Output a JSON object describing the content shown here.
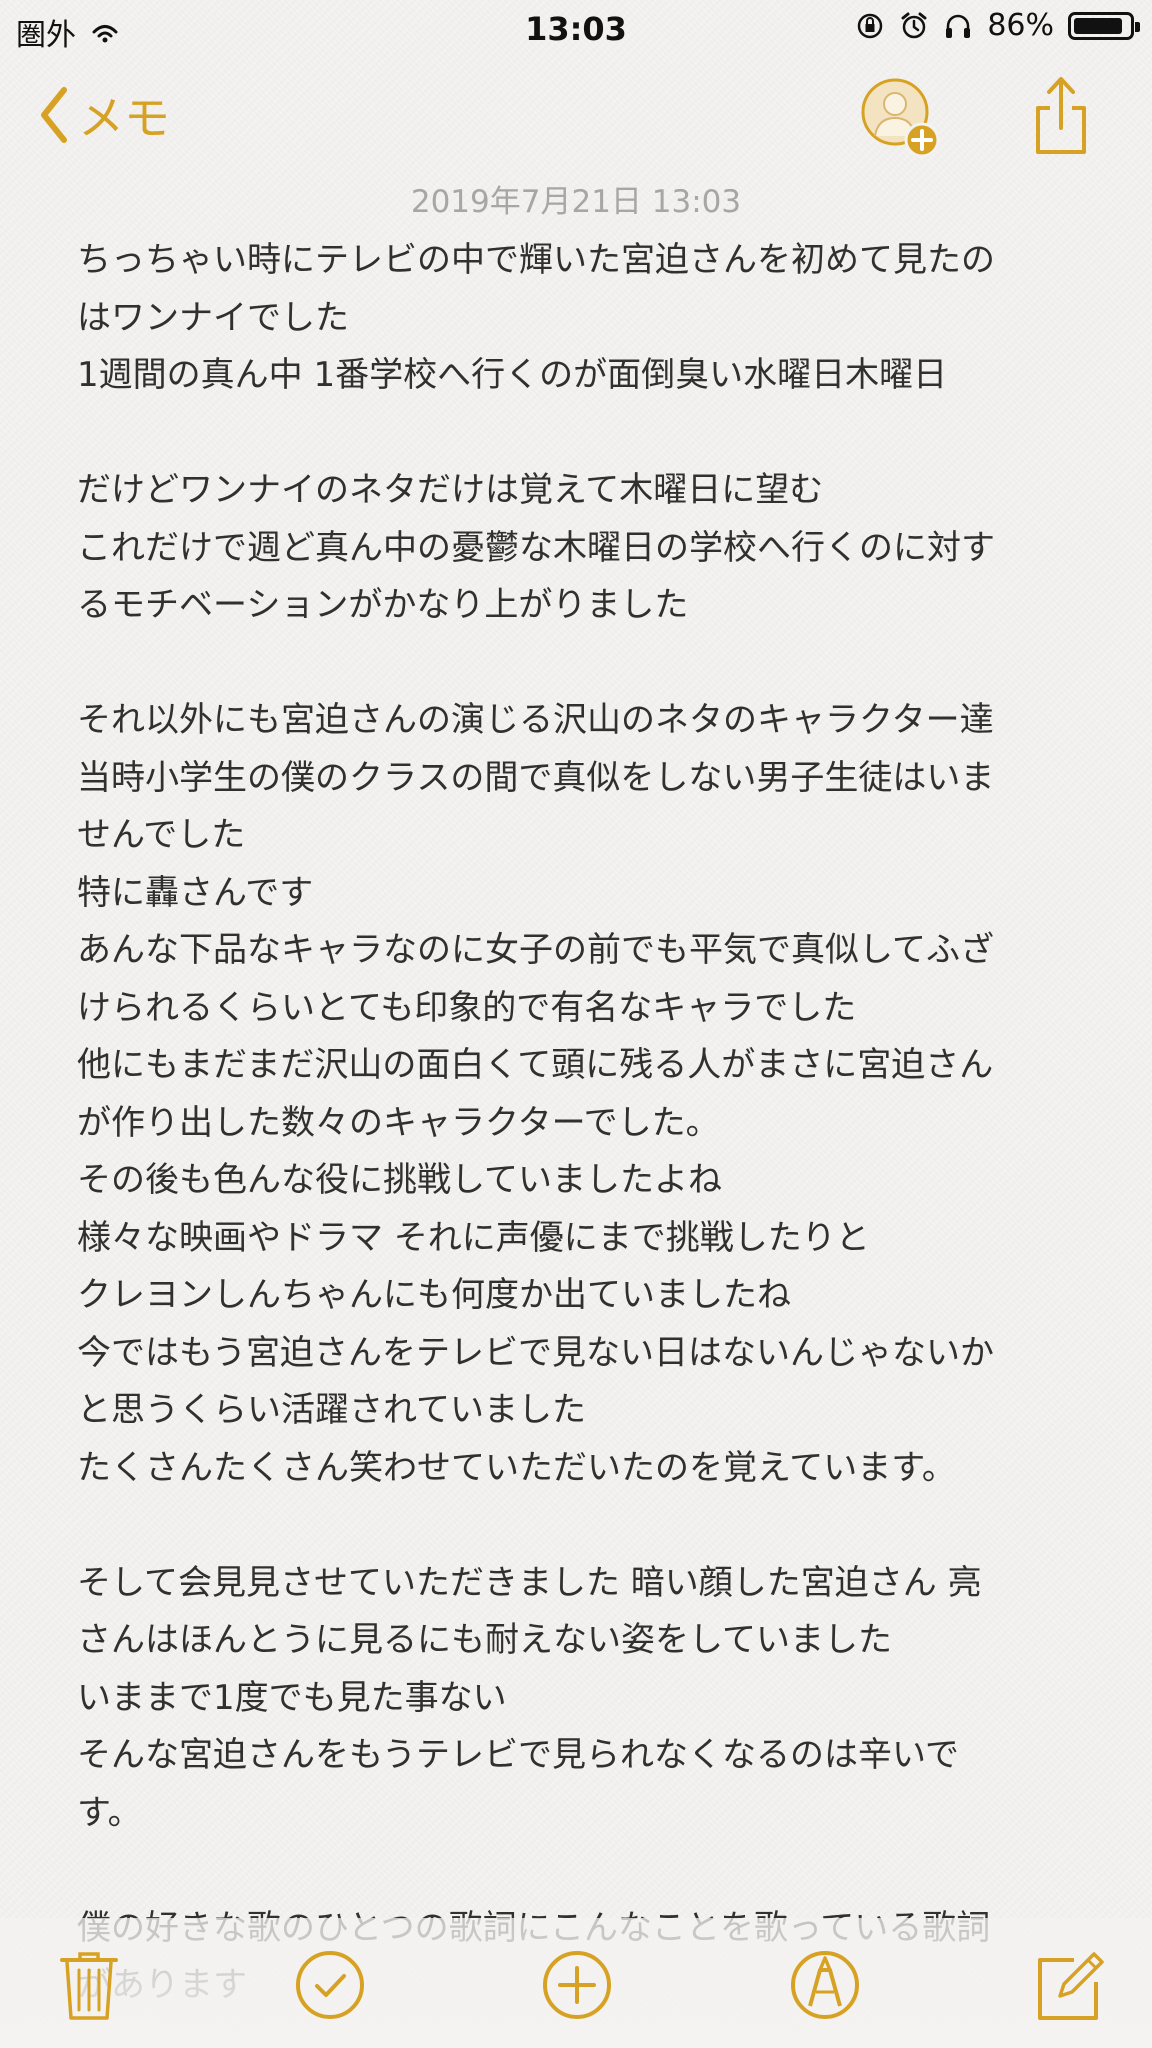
{
  "status_bar": {
    "carrier": "圏外",
    "time": "13:03",
    "battery": "86%",
    "battery_level": 0.86,
    "icons": [
      "wifi-icon",
      "rotation-lock-icon",
      "alarm-icon",
      "headphones-icon",
      "battery-icon"
    ]
  },
  "nav": {
    "back_label": "メモ",
    "icons": [
      "chevron-left-icon",
      "add-person-icon",
      "share-icon"
    ]
  },
  "note": {
    "date": "2019年7月21日 13:03",
    "lines": [
      "ちっちゃい時にテレビの中で輝いた宮迫さんを初めて見たの",
      "はワンナイでした",
      "1週間の真ん中 1番学校へ行くのが面倒臭い水曜日木曜日",
      "",
      "だけどワンナイのネタだけは覚えて木曜日に望む",
      "これだけで週ど真ん中の憂鬱な木曜日の学校へ行くのに対す",
      "るモチベーションがかなり上がりました",
      "",
      "それ以外にも宮迫さんの演じる沢山のネタのキャラクター達",
      "当時小学生の僕のクラスの間で真似をしない男子生徒はいま",
      "せんでした",
      "特に轟さんです",
      "あんな下品なキャラなのに女子の前でも平気で真似してふざ",
      "けられるくらいとても印象的で有名なキャラでした",
      "他にもまだまだ沢山の面白くて頭に残る人がまさに宮迫さん",
      "が作り出した数々のキャラクターでした。",
      "その後も色んな役に挑戦していましたよね",
      "様々な映画やドラマ それに声優にまで挑戦したりと",
      "クレヨンしんちゃんにも何度か出ていましたね",
      "今ではもう宮迫さんをテレビで見ない日はないんじゃないか",
      "と思うくらい活躍されていました",
      "たくさんたくさん笑わせていただいたのを覚えています。",
      "",
      "そして会見見させていただきました 暗い顔した宮迫さん 亮",
      "さんはほんとうに見るにも耐えない姿をしていました",
      "いままで1度でも見た事ない",
      "そんな宮迫さんをもうテレビで見られなくなるのは辛いで",
      "す。",
      "",
      "僕の好きな歌のひとつの歌詞にこんなことを歌っている歌詞",
      "があります"
    ]
  },
  "toolbar": {
    "icons": [
      "trash-icon",
      "checklist-icon",
      "add-icon",
      "markup-pen-icon",
      "compose-icon"
    ]
  },
  "colors": {
    "accent": "#d7a223",
    "paper": "#f4f3f1",
    "date_text": "#a6a6a6",
    "body_text": "#303030"
  }
}
